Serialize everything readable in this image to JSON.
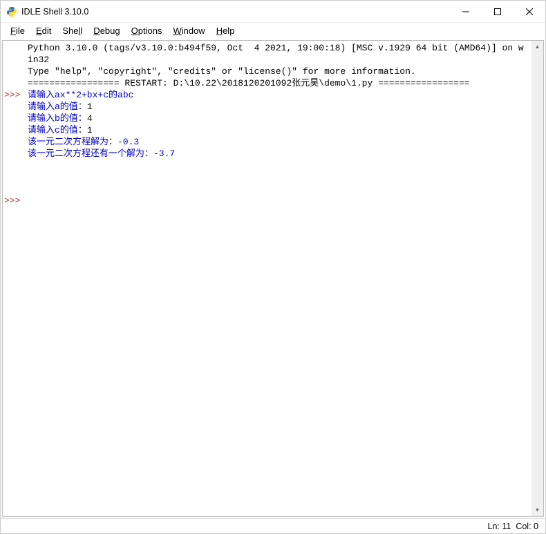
{
  "window": {
    "title": "IDLE Shell 3.10.0"
  },
  "menu": {
    "file": "File",
    "edit": "Edit",
    "shell": "Shell",
    "debug": "Debug",
    "options": "Options",
    "window": "Window",
    "help": "Help"
  },
  "shell": {
    "banner1": "Python 3.10.0 (tags/v3.10.0:b494f59, Oct  4 2021, 19:00:18) [MSC v.1929 64 bit (AMD64)] on win32",
    "banner2": "Type \"help\", \"copyright\", \"credits\" or \"license()\" for more information.",
    "restart_line": "================= RESTART: D:\\10.22\\2018120201092张元昊\\demo\\1.py =================",
    "out1": "请输入ax**2+bx+c的abc",
    "out2_label": "请输入a的值：",
    "out2_input": "1",
    "out3_label": "请输入b的值：",
    "out3_input": "4",
    "out4_label": "请输入c的值：",
    "out4_input": "1",
    "out5": "该一元二次方程解为：-0.3",
    "out6": "该一元二次方程还有一个解为：-3.7",
    "prompt": ">>>"
  },
  "status": {
    "ln_label": "Ln:",
    "ln_value": "11",
    "col_label": "Col:",
    "col_value": "0"
  }
}
